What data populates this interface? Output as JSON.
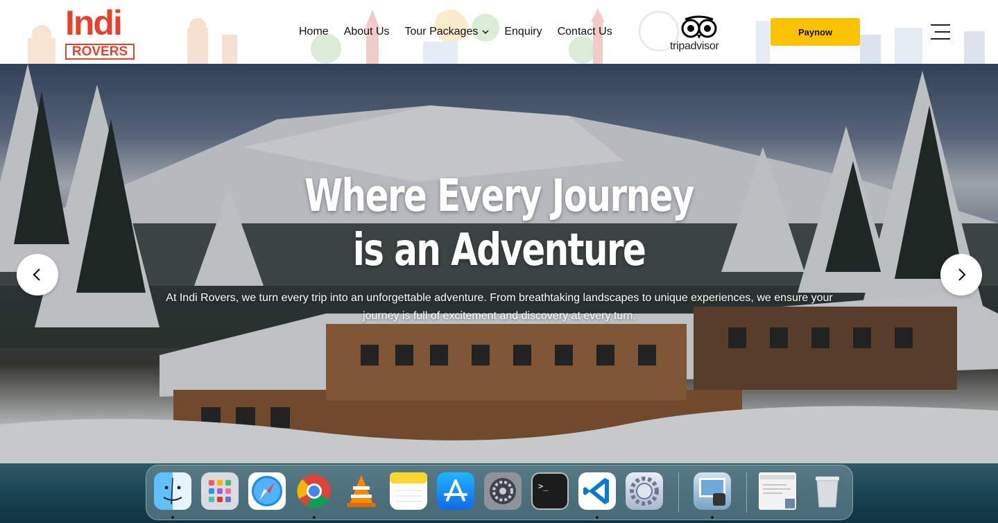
{
  "brand": {
    "logo_top": "Indi",
    "logo_bottom": "ROVERS",
    "accent": "#e8402a"
  },
  "nav": {
    "items": [
      {
        "label": "Home"
      },
      {
        "label": "About Us"
      },
      {
        "label": "Tour Packages",
        "has_dropdown": true
      },
      {
        "label": "Enquiry"
      },
      {
        "label": "Contact Us"
      }
    ]
  },
  "tripadvisor": {
    "label": "tripadvisor"
  },
  "paynow": {
    "label": "Paynow",
    "color": "#f9c304"
  },
  "hero": {
    "title_line1": "Where Every Journey",
    "title_line2": "is an Adventure",
    "description_line1": "At Indi Rovers, we turn every trip into an unforgettable adventure. From breathtaking landscapes to unique experiences, we ensure your",
    "description_line2": "journey is full of excitement and discovery at every turn."
  },
  "carousel": {
    "prev_icon": "chevron-left-icon",
    "next_icon": "chevron-right-icon"
  },
  "dock": {
    "apps": [
      {
        "name": "finder",
        "running": true
      },
      {
        "name": "launchpad",
        "running": false
      },
      {
        "name": "safari",
        "running": false
      },
      {
        "name": "chrome",
        "running": true
      },
      {
        "name": "vlc",
        "running": false
      },
      {
        "name": "notes",
        "running": false
      },
      {
        "name": "app-store",
        "running": false
      },
      {
        "name": "system-settings",
        "running": false
      },
      {
        "name": "terminal",
        "running": false
      },
      {
        "name": "vscode",
        "running": true
      },
      {
        "name": "system-preferences-gear",
        "running": false
      },
      {
        "name": "preview",
        "running": true
      },
      {
        "name": "document-window",
        "running": false
      },
      {
        "name": "trash",
        "running": false
      }
    ]
  }
}
